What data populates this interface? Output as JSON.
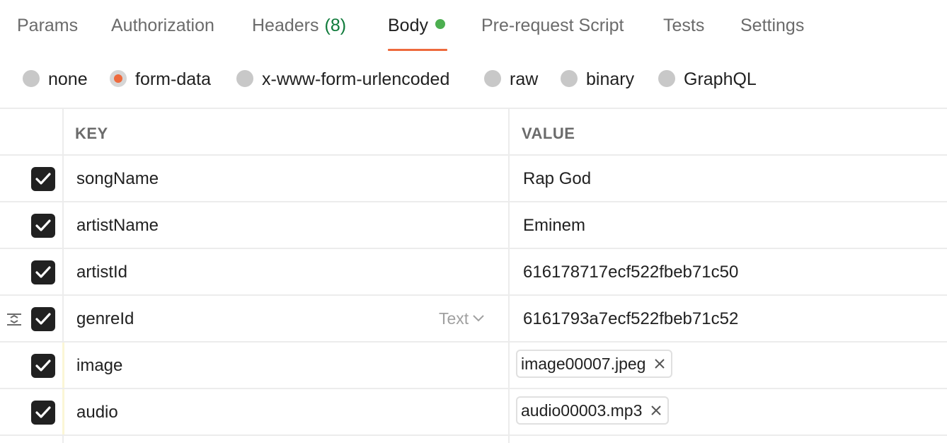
{
  "tabs": [
    {
      "label": "Params"
    },
    {
      "label": "Authorization"
    },
    {
      "label": "Headers",
      "count": "(8)"
    },
    {
      "label": "Body",
      "active": true
    },
    {
      "label": "Pre-request Script"
    },
    {
      "label": "Tests"
    },
    {
      "label": "Settings"
    }
  ],
  "colors": {
    "accent": "#ee6a3d",
    "body_dot": "#4caf50",
    "count_green": "#0e7a3a"
  },
  "body_types": [
    {
      "label": "none"
    },
    {
      "label": "form-data",
      "selected": true
    },
    {
      "label": "x-www-form-urlencoded"
    },
    {
      "label": "raw"
    },
    {
      "label": "binary"
    },
    {
      "label": "GraphQL"
    }
  ],
  "table": {
    "headers": {
      "key": "KEY",
      "value": "VALUE"
    },
    "rows": [
      {
        "key": "songName",
        "value": "Rap God",
        "checked": true
      },
      {
        "key": "artistName",
        "value": "Eminem",
        "checked": true
      },
      {
        "key": "artistId",
        "value": "616178717ecf522fbeb71c50",
        "checked": true
      },
      {
        "key": "genreId",
        "value": "6161793a7ecf522fbeb71c52",
        "checked": true,
        "type_label": "Text"
      },
      {
        "key": "image",
        "file": "image00007.jpeg",
        "checked": true
      },
      {
        "key": "audio",
        "file": "audio00003.mp3",
        "checked": true
      }
    ]
  }
}
